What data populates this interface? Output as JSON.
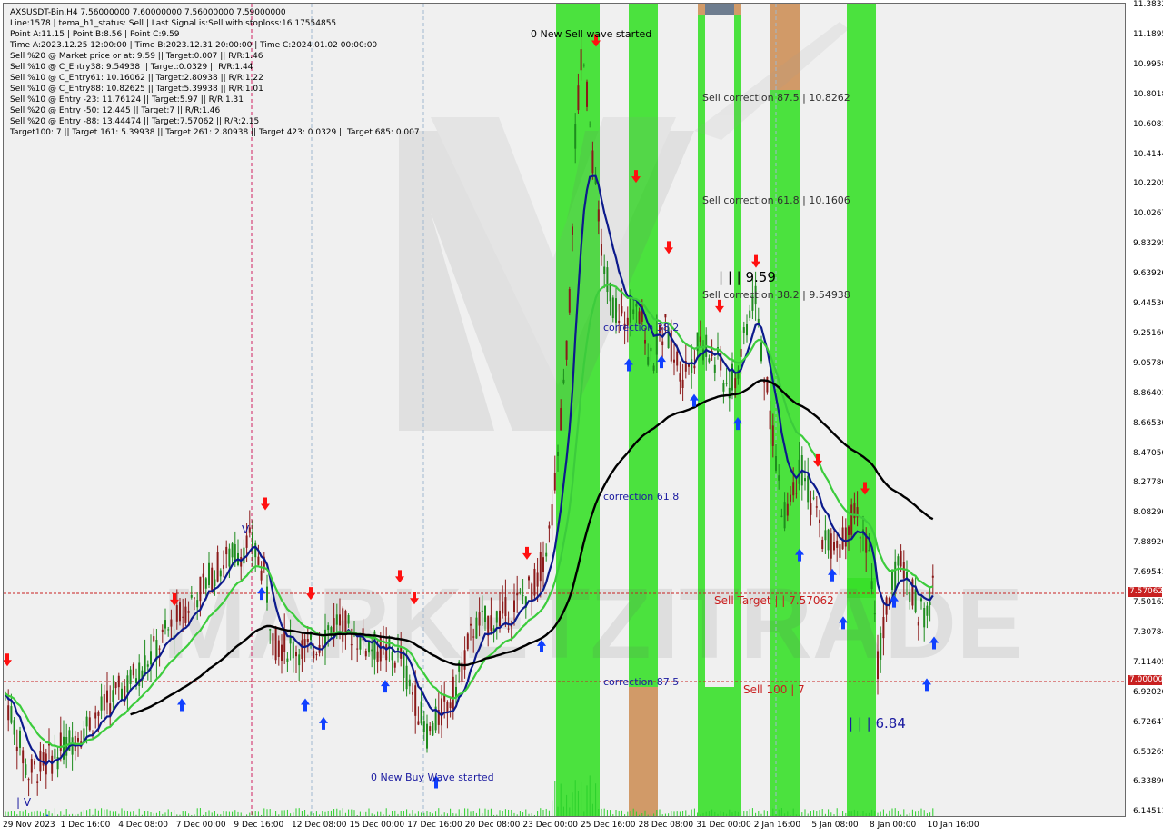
{
  "info_lines": [
    "AXSUSDT-Bin,H4  7.56000000 7.60000000 7.56000000 7.59000000",
    "Line:1578  | tema_h1_status: Sell  | Last Signal is:Sell with stoploss:16.17554855",
    "Point A:11.15  | Point B:8.56  | Point C:9.59",
    "Time A:2023.12.25 12:00:00  | Time B:2023.12.31 20:00:00  | Time C:2024.01.02 00:00:00",
    "Sell %20 @ Market price or at: 9.59  || Target:0.007  || R/R:1.46",
    "Sell %10 @ C_Entry38: 9.54938  || Target:0.0329  || R/R:1.44",
    "Sell %10 @ C_Entry61: 10.16062  || Target:2.80938  || R/R:1.22",
    "Sell %10 @ C_Entry88: 10.82625  || Target:5.39938  || R/R:1.01",
    "Sell %10 @ Entry -23: 11.76124  || Target:5.97  || R/R:1.31",
    "Sell %20 @ Entry -50: 12.445  || Target:7  || R/R:1.46",
    "Sell %20 @ Entry -88: 13.44474  || Target:7.57062  || R/R:2.15",
    "Target100: 7  || Target 161: 5.39938  || Target 261: 2.80938  || Target 423: 0.0329  || Target 685: 0.007"
  ],
  "y_axis": {
    "ticks": [
      "11.38320",
      "11.18950",
      "10.99580",
      "10.80180",
      "10.60810",
      "10.41440",
      "10.22050",
      "10.02670",
      "9.83295",
      "9.63920",
      "9.44530",
      "9.25160",
      "9.05780",
      "8.86401",
      "8.66530",
      "8.47050",
      "8.27780",
      "8.08290",
      "7.88920",
      "7.69541",
      "7.50162",
      "7.30784",
      "7.11405",
      "6.92026",
      "6.72647",
      "6.53269",
      "6.33890",
      "6.14511"
    ],
    "price_tags": [
      "7.57062",
      "7.00000"
    ]
  },
  "x_axis": {
    "ticks": [
      "29 Nov 2023",
      "1 Dec 16:00",
      "4 Dec 08:00",
      "7 Dec 00:00",
      "9 Dec 16:00",
      "12 Dec 08:00",
      "15 Dec 00:00",
      "17 Dec 16:00",
      "20 Dec 08:00",
      "23 Dec 00:00",
      "25 Dec 16:00",
      "28 Dec 08:00",
      "31 Dec 00:00",
      "2 Jan 16:00",
      "5 Jan 08:00",
      "8 Jan 00:00",
      "10 Jan 16:00"
    ]
  },
  "annotations": {
    "new_sell_wave": "0 New Sell wave started",
    "new_buy_wave": "0 New Buy Wave started",
    "sell_corr_875": "Sell correction 87.5 | 10.8262",
    "sell_corr_618": "Sell correction 61.8 | 10.1606",
    "sell_corr_382": "Sell correction 38.2 | 9.54938",
    "point_c": "| | | 9.59",
    "corr_382": "correction 38.2",
    "corr_618": "correction 61.8",
    "corr_875": "correction 87.5",
    "sell_target": "Sell Target | | 7.57062",
    "sell_100": "Sell 100 | 7",
    "point_low": "| | | 6.84",
    "point_iv": "| V",
    "point_v": "V",
    "watermark": "MARKETZITRADE"
  },
  "colors": {
    "background": "#f0f0f0",
    "bull_candle": "#1e8c1e",
    "bear_candle": "#8b1a1a",
    "green_band": "#39e02a",
    "orange_band": "#d8966a",
    "tema_line": "#0c1a8c",
    "ma_green": "#3ccc3c",
    "ma_black": "#000000",
    "sell_arrow": "#ff1010",
    "buy_arrow": "#1040ff",
    "price_tag": "#c82020",
    "level_line": "#c82020"
  }
}
